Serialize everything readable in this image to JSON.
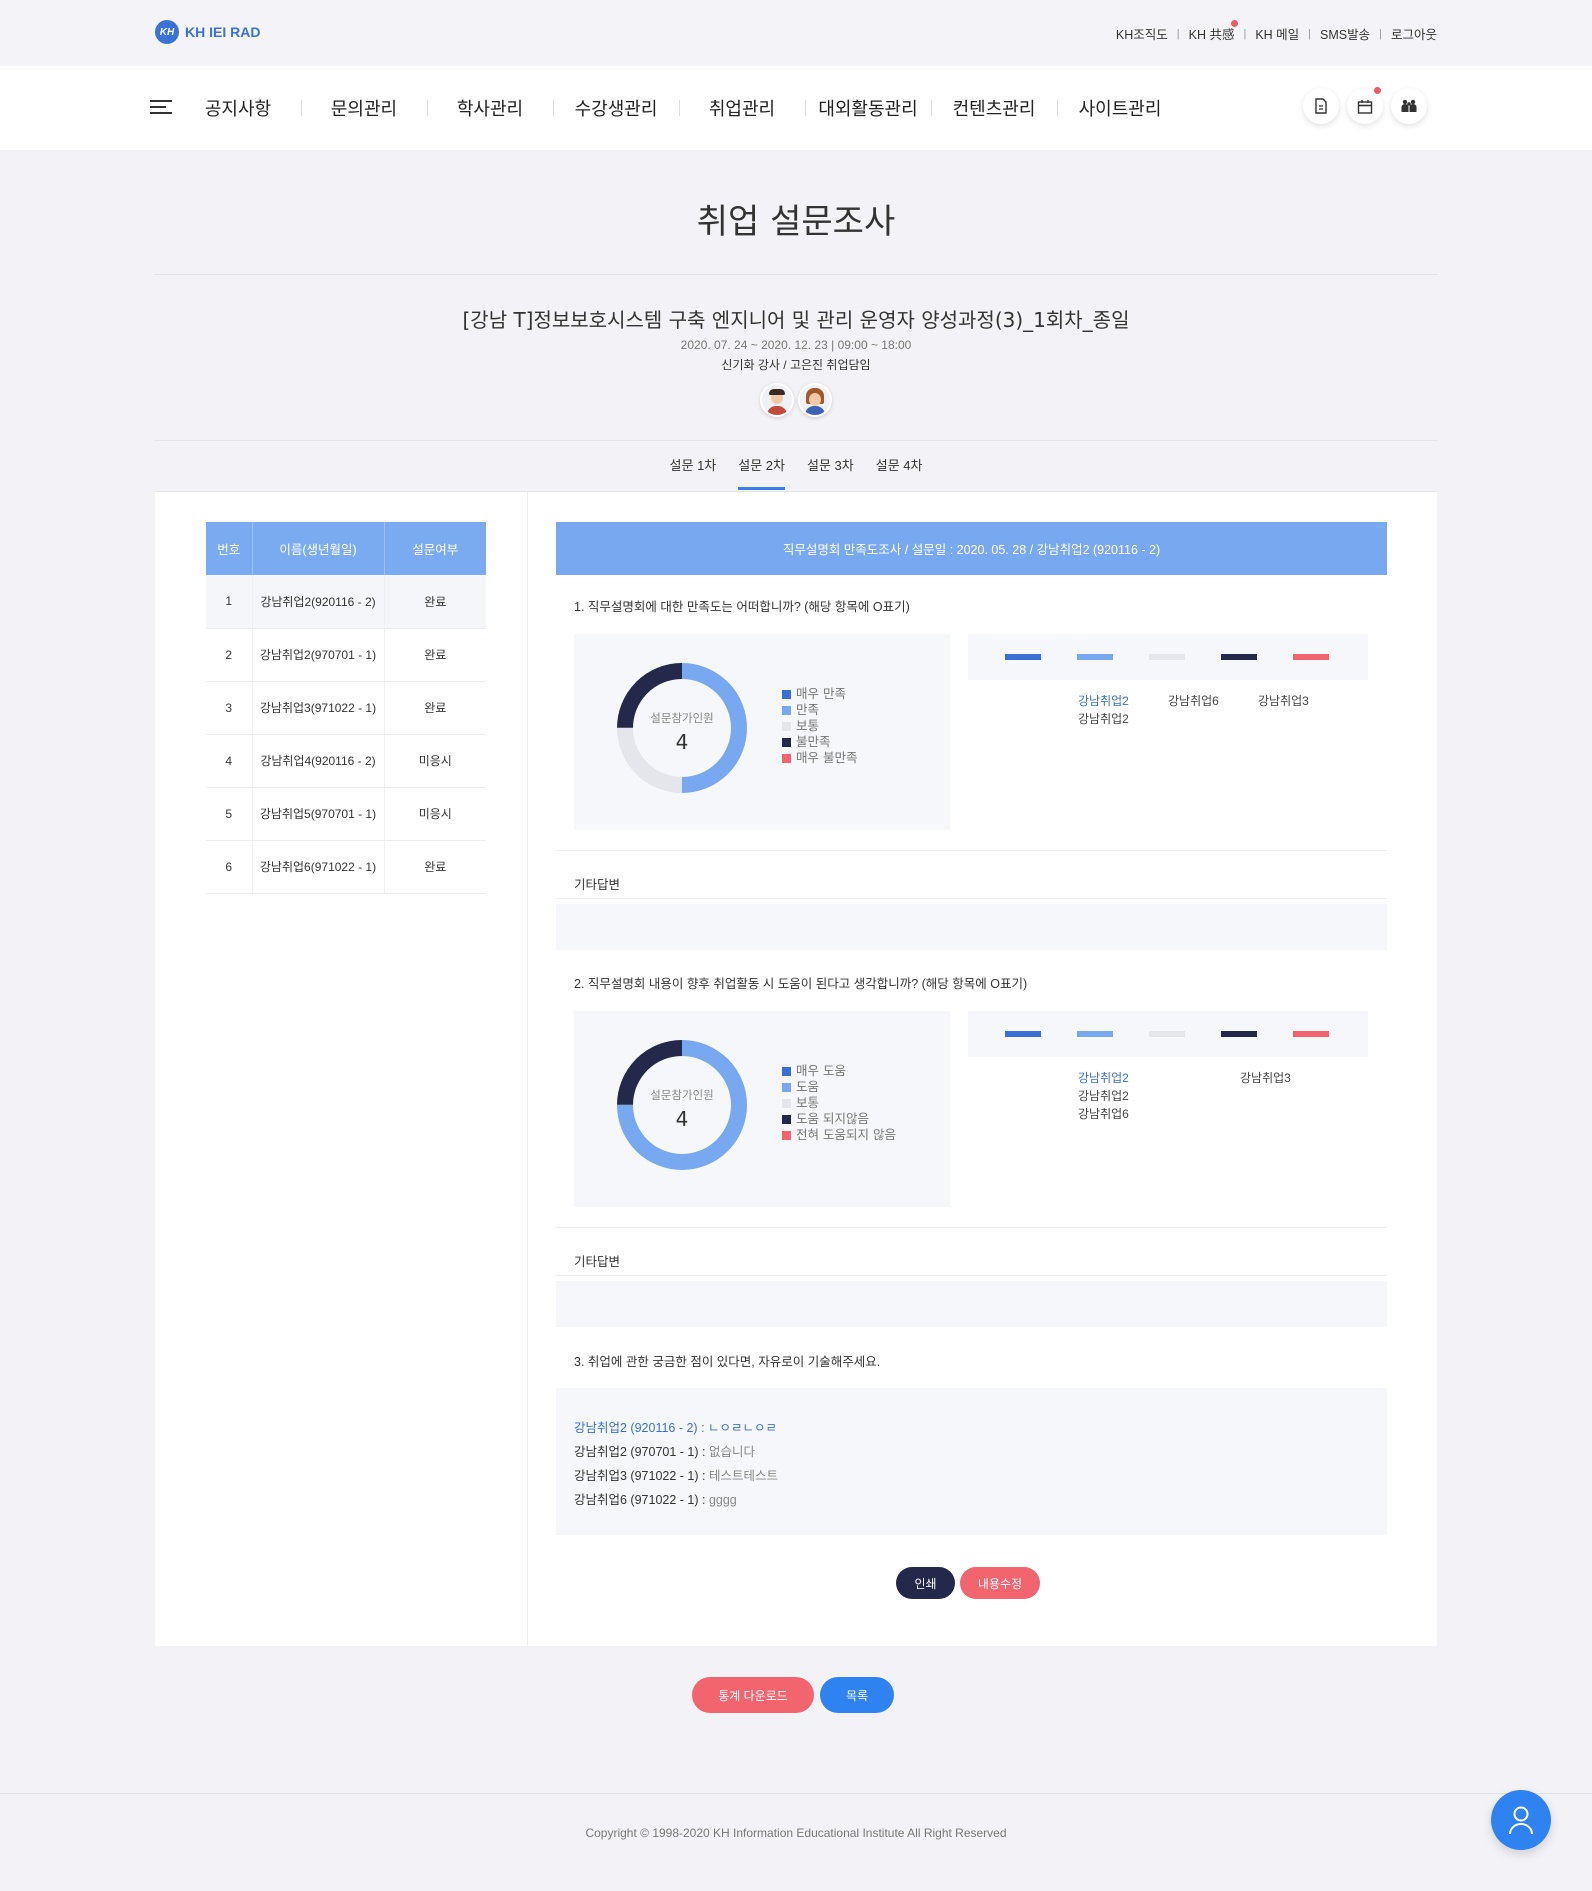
{
  "header": {
    "logo_text": "KH IEI RAD",
    "logo_mark": "KH",
    "util_links": [
      "KH조직도",
      "KH 共感",
      "KH 메일",
      "SMS발송",
      "로그아웃"
    ],
    "util_separator": "|"
  },
  "nav": {
    "items": [
      "공지사항",
      "문의관리",
      "학사관리",
      "수강생관리",
      "취업관리",
      "대외활동관리",
      "컨텐츠관리",
      "사이트관리"
    ],
    "icons": [
      "document-icon",
      "calendar-icon",
      "people-icon"
    ]
  },
  "page": {
    "title": "취업 설문조사",
    "course_title": "[강남 T]정보보호시스템 구축 엔지니어 및 관리 운영자 양성과정(3)_1회차_종일",
    "date_line": "2020. 07. 24 ~ 2020. 12. 23 | 09:00 ~ 18:00",
    "teachers": "신기화 강사 / 고은진 취업담임"
  },
  "tabs": [
    "설문 1차",
    "설문 2차",
    "설문 3차",
    "설문 4차"
  ],
  "active_tab": 1,
  "list": {
    "headers": [
      "번호",
      "이름(생년월일)",
      "설문여부"
    ],
    "rows": [
      {
        "no": "1",
        "name": "강남취업2(920116 - 2)",
        "status": "완료"
      },
      {
        "no": "2",
        "name": "강남취업2(970701 - 1)",
        "status": "완료"
      },
      {
        "no": "3",
        "name": "강남취업3(971022 - 1)",
        "status": "완료"
      },
      {
        "no": "4",
        "name": "강남취업4(920116 - 2)",
        "status": "미응시"
      },
      {
        "no": "5",
        "name": "강남취업5(970701 - 1)",
        "status": "미응시"
      },
      {
        "no": "6",
        "name": "강남취업6(971022 - 1)",
        "status": "완료"
      }
    ]
  },
  "survey": {
    "header": "직무설명회 만족도조사 /  설문일 : 2020. 05. 28 /  강남취업2 (920116 - 2)",
    "participants_label": "설문참가인원",
    "q1": {
      "question": "1. 직무설명회에 대한 만족도는 어떠합니까? (해당 항목에 O표기)",
      "participants": "4",
      "legend": [
        "매우 만족",
        "만족",
        "보통",
        "불만족",
        "매우 불만족"
      ],
      "donut_fractions": [
        0,
        0.5,
        0.25,
        0.25,
        0
      ],
      "names_col1": [
        "강남취업2",
        "강남취업2"
      ],
      "names_col2": [
        "강남취업6"
      ],
      "names_col3": [
        "강남취업3"
      ]
    },
    "q2": {
      "question": "2. 직무설명회 내용이 향후 취업활동 시 도움이 된다고 생각합니까? (해당 항목에 O표기)",
      "participants": "4",
      "legend": [
        "매우 도움",
        "도움",
        "보통",
        "도움 되지않음",
        "전혀 도움되지 않음"
      ],
      "donut_fractions": [
        0,
        0.75,
        0,
        0.25,
        0
      ],
      "names_col1": [
        "강남취업2",
        "강남취업2",
        "강남취업6"
      ],
      "names_col2": [
        "강남취업3"
      ]
    },
    "etc_label": "기타답변",
    "q3": {
      "question": "3. 취업에 관한 궁금한 점이 있다면, 자유로이 기술해주세요.",
      "answers": [
        {
          "who": "강남취업2 (920116 - 2) :",
          "text": " ㄴㅇㄹㄴㅇㄹ"
        },
        {
          "who": "강남취업2 (970701 - 1) :",
          "text": " 없습니다"
        },
        {
          "who": "강남취업3 (971022 - 1) :",
          "text": " 테스트테스트"
        },
        {
          "who": "강남취업6 (971022 - 1) :",
          "text": " gggg"
        }
      ]
    },
    "colors": [
      "#3a6fd6",
      "#78a8f0",
      "#e4e6ec",
      "#24284a",
      "#f2646e"
    ]
  },
  "buttons": {
    "print": "인쇄",
    "edit": "내용수정",
    "stats_download": "통계 다운로드",
    "list": "목록"
  },
  "footer": {
    "copyright": "Copyright © 1998-2020 KH Information Educational Institute All Right Reserved"
  }
}
